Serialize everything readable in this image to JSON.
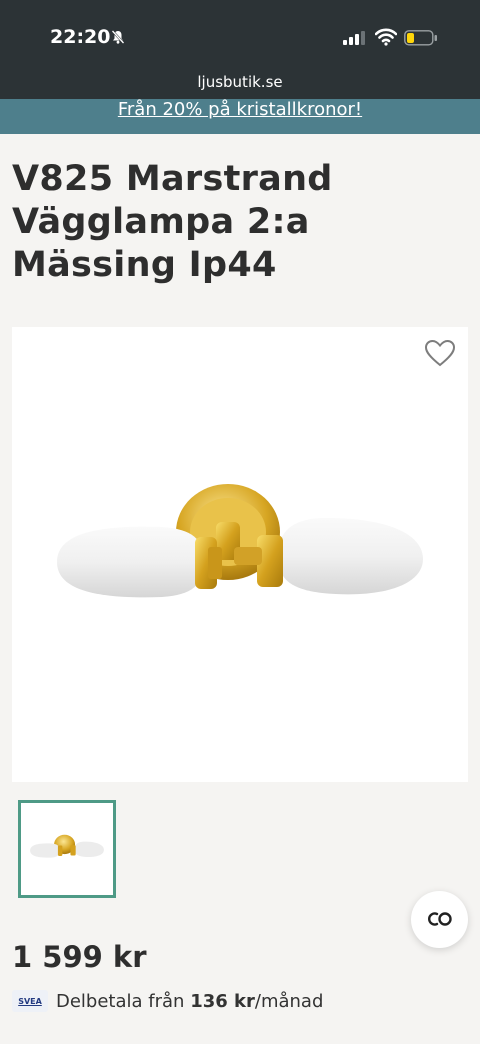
{
  "status_bar": {
    "time": "22:20",
    "icons": [
      "bell-slash-icon",
      "signal-icon",
      "wifi-icon",
      "battery-icon"
    ]
  },
  "browser": {
    "url": "ljusbutik.se"
  },
  "promo": {
    "text": "Från 20% på kristallkronor!"
  },
  "product": {
    "title": "V825 Marstrand Vägglampa 2:a Mässing Ip44",
    "price": "1 599 kr",
    "installment": {
      "provider": "SVEA",
      "prefix": "Delbetala från",
      "amount": "136 kr",
      "suffix": "/månad"
    },
    "wishlist_icon": "heart-icon",
    "thumbnails": 1
  },
  "chat": {
    "icon": "chat-icon"
  },
  "colors": {
    "status_bg": "#2c3336",
    "promo_bg": "#4e7f8c",
    "thumb_border": "#4e9a86",
    "page_bg": "#f5f4f2"
  }
}
